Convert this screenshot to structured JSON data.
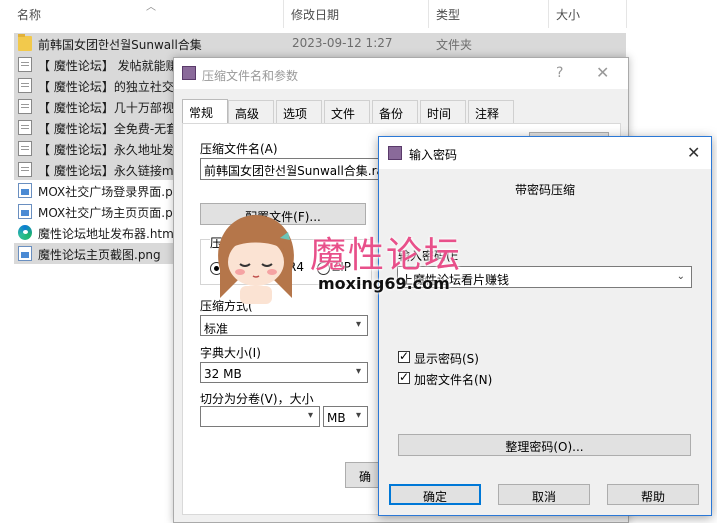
{
  "explorer": {
    "columns": [
      "名称",
      "修改日期",
      "类型",
      "大小"
    ],
    "rows": [
      {
        "name": "前韩国女团한선월Sunwall合集",
        "date": "2023-09-12 1:27",
        "type": "文件夹",
        "icon": "folder-icon",
        "selected": true
      },
      {
        "name": "【 魔性论坛】 发帖就能赚",
        "date": "",
        "type": "",
        "icon": "text-file-icon",
        "selected": true
      },
      {
        "name": "【 魔性论坛】的独立社交",
        "date": "",
        "type": "",
        "icon": "text-file-icon",
        "selected": true
      },
      {
        "name": "【 魔性论坛】几十万部视",
        "date": "",
        "type": "",
        "icon": "text-file-icon",
        "selected": true
      },
      {
        "name": "【 魔性论坛】全免费-无套",
        "date": "",
        "type": "",
        "icon": "text-file-icon",
        "selected": true
      },
      {
        "name": "【 魔性论坛】永久地址发",
        "date": "",
        "type": "",
        "icon": "text-file-icon",
        "selected": true
      },
      {
        "name": "【 魔性论坛】永久链接m",
        "date": "",
        "type": "",
        "icon": "text-file-icon",
        "selected": true
      },
      {
        "name": "MOX社交广场登录界面.p",
        "date": "",
        "type": "",
        "icon": "image-file-icon",
        "selected": false
      },
      {
        "name": "MOX社交广场主页页面.p",
        "date": "",
        "type": "",
        "icon": "image-file-icon",
        "selected": false
      },
      {
        "name": "魔性论坛地址发布器.html",
        "date": "",
        "type": "",
        "icon": "edge-html-icon",
        "selected": false
      },
      {
        "name": "魔性论坛主页截图.png",
        "date": "",
        "type": "",
        "icon": "image-file-icon",
        "selected": true
      }
    ]
  },
  "archive_dialog": {
    "title": "压缩文件名和参数",
    "help": "?",
    "close": "✕",
    "tabs": [
      "常规",
      "高级",
      "选项",
      "文件",
      "备份",
      "时间",
      "注释"
    ],
    "archive_name_label": "压缩文件名(A)",
    "archive_name_value": "前韩国女团한선월Sunwall合集.rar",
    "profile_button": "配置文件(F)...",
    "format_label": "压",
    "format_options": [
      "R",
      "R4",
      "ZIP"
    ],
    "method_label": "压缩方式(",
    "method_value": "标准",
    "dict_label": "字典大小(I)",
    "dict_value": "32 MB",
    "split_label": "切分为分卷(V)，大小",
    "split_value": "",
    "split_unit": "MB",
    "ok_partial": "确"
  },
  "password_dialog": {
    "title": "输入密码",
    "close": "✕",
    "heading": "带密码压缩",
    "input_label": "输入密码(E",
    "input_value": "上魔性论坛看片赚钱",
    "show_password": "显示密码(S)",
    "encrypt_names": "加密文件名(N)",
    "organize_button": "整理密码(O)...",
    "ok": "确定",
    "cancel": "取消",
    "help": "帮助"
  },
  "watermark": {
    "text": "魔性论坛",
    "url": "moxing69.com"
  },
  "colors": {
    "selection": "#d9d9d9",
    "accent": "#0078d7",
    "watermark": "#e8508a"
  }
}
